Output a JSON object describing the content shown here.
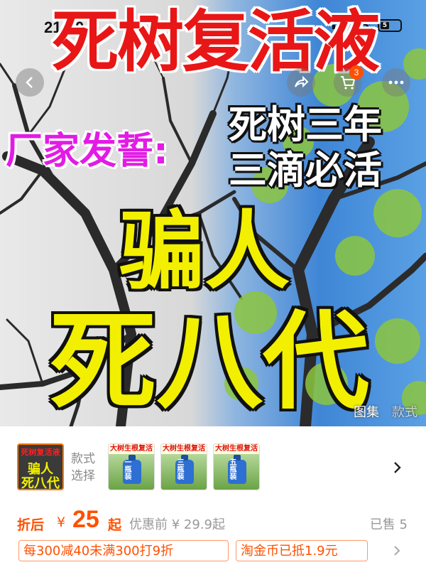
{
  "status_bar": {
    "time": "21:40",
    "battery": "5"
  },
  "hero": {
    "title": "死树复活液",
    "vow": "厂家发誓:",
    "claim_line1": "死树三年",
    "claim_line2": "三滴必活",
    "scam_line1": "骗人",
    "scam_line2": "死八代"
  },
  "nav": {
    "cart_count": "3",
    "icons": [
      "chevron-left-icon",
      "share-icon",
      "cart-icon",
      "more-icon"
    ]
  },
  "gallery_tabs": {
    "active": "图集",
    "inactive": "款式"
  },
  "variants": {
    "style_label": "款式选择",
    "selected_thumb": {
      "line1": "死树复活液",
      "line2": "骗人",
      "line3": "死八代"
    },
    "options": [
      {
        "header": "大树生根复活",
        "tag": "一瓶装"
      },
      {
        "header": "大树生根复活",
        "tag": "三瓶装"
      },
      {
        "header": "大树生根复活",
        "tag": "五瓶装"
      }
    ]
  },
  "price": {
    "after_label": "折后",
    "currency": "¥",
    "amount": "25",
    "suffix": "起",
    "before_label": "优惠前 ¥ 29.9起",
    "sold": "已售 5"
  },
  "coupons": [
    "每300减40未满300打9折",
    "淘金币已抵1.9元"
  ],
  "colors": {
    "accent": "#ff5000",
    "title_red": "#e81616",
    "vow_magenta": "#e21be5",
    "scam_yellow": "#f2f000"
  }
}
